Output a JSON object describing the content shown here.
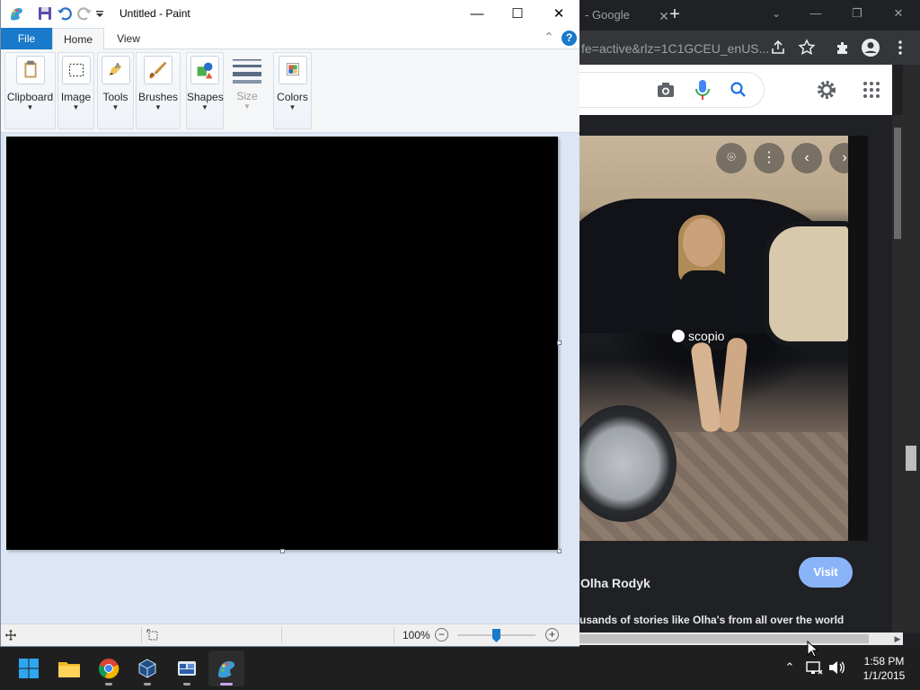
{
  "chrome": {
    "tab_title": "- Google",
    "tab_close_glyph": "✕",
    "new_tab_glyph": "+",
    "window_controls": {
      "minimize": "—",
      "restore": "❐",
      "close": "✕"
    },
    "url_fragment": "fe=active&rlz=1C1GCEU_enUS...",
    "photo": {
      "watermark": "scopio",
      "lens_glyph": "⌾",
      "more_glyph": "⋮",
      "prev_glyph": "‹",
      "next_glyph": "›"
    },
    "author_name": "Olha Rodyk",
    "visit_label": "Visit",
    "description_fragment": "usands of stories like Olha's from all over the world",
    "hscroll_arrow": "▶"
  },
  "paint": {
    "title": "Untitled - Paint",
    "window_controls": {
      "minimize": "—",
      "maximize": "☐",
      "close": "✕"
    },
    "tabs": {
      "file": "File",
      "home": "Home",
      "view": "View"
    },
    "ribbon": {
      "clipboard": "Clipboard",
      "image": "Image",
      "tools": "Tools",
      "brushes": "Brushes",
      "shapes": "Shapes",
      "size": "Size",
      "colors": "Colors"
    },
    "dropdown_glyph": "▼",
    "collapse_glyph": "⌃",
    "help_glyph": "?",
    "status": {
      "zoom": "100%",
      "zoom_out": "−",
      "zoom_in": "+",
      "zoom_fraction": 0.5
    }
  },
  "taskbar": {
    "time": "1:58 PM",
    "date": "1/1/2015",
    "tray_chevron": "⌃"
  },
  "colors": {
    "paint_file_tab": "#1979ca",
    "chrome_bg": "#202124",
    "visit_button": "#8ab4f8",
    "google_blue": "#1a73e8"
  }
}
